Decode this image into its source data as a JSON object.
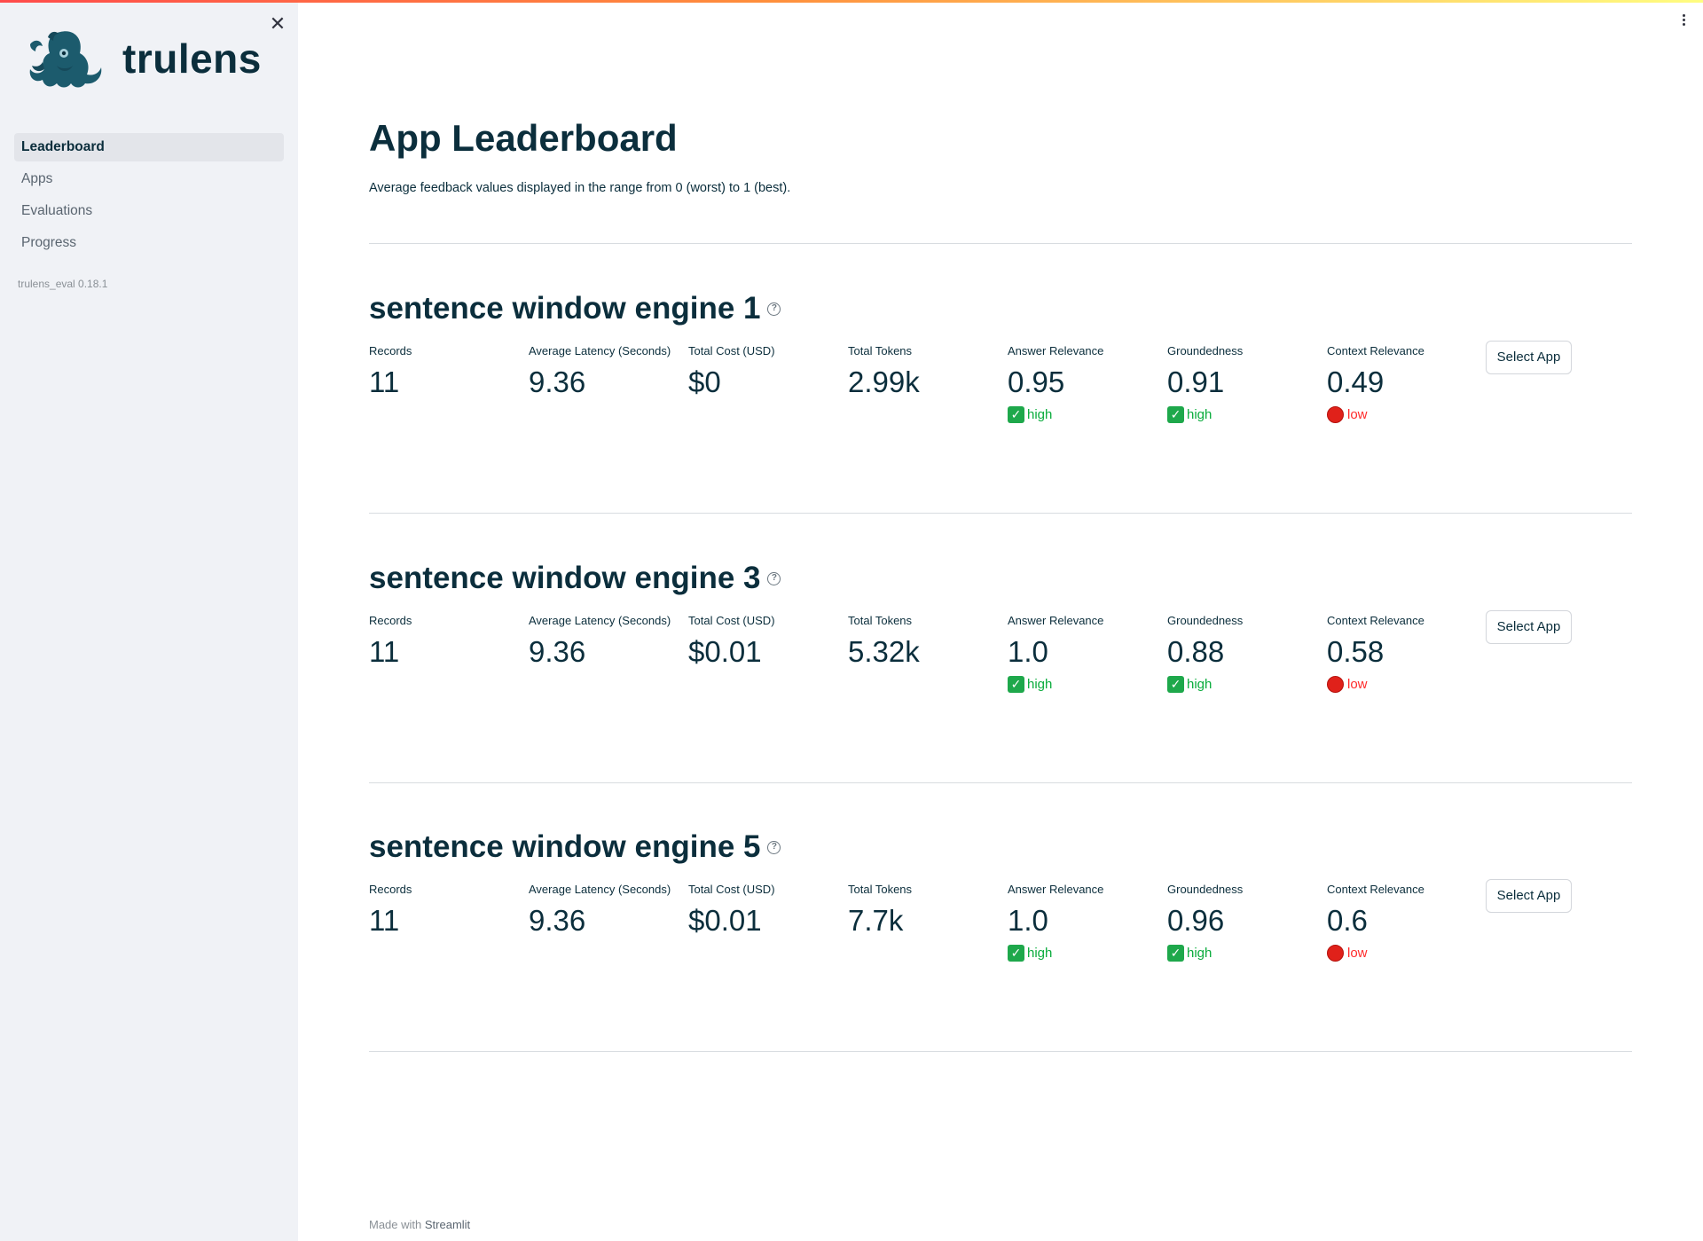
{
  "sidebar": {
    "logo_text": "trulens",
    "nav": [
      {
        "label": "Leaderboard",
        "active": true
      },
      {
        "label": "Apps",
        "active": false
      },
      {
        "label": "Evaluations",
        "active": false
      },
      {
        "label": "Progress",
        "active": false
      }
    ],
    "version": "trulens_eval 0.18.1"
  },
  "main": {
    "title": "App Leaderboard",
    "caption": "Average feedback values displayed in the range from 0 (worst) to 1 (best).",
    "apps": [
      {
        "name": "sentence window engine 1",
        "metrics": {
          "records": {
            "label": "Records",
            "value": "11"
          },
          "latency": {
            "label": "Average Latency (Seconds)",
            "value": "9.36"
          },
          "cost": {
            "label": "Total Cost (USD)",
            "value": "$0"
          },
          "tokens": {
            "label": "Total Tokens",
            "value": "2.99k"
          },
          "answer_relevance": {
            "label": "Answer Relevance",
            "value": "0.95",
            "delta": "high"
          },
          "groundedness": {
            "label": "Groundedness",
            "value": "0.91",
            "delta": "high"
          },
          "context_relevance": {
            "label": "Context Relevance",
            "value": "0.49",
            "delta": "low"
          }
        },
        "select_label": "Select App"
      },
      {
        "name": "sentence window engine 3",
        "metrics": {
          "records": {
            "label": "Records",
            "value": "11"
          },
          "latency": {
            "label": "Average Latency (Seconds)",
            "value": "9.36"
          },
          "cost": {
            "label": "Total Cost (USD)",
            "value": "$0.01"
          },
          "tokens": {
            "label": "Total Tokens",
            "value": "5.32k"
          },
          "answer_relevance": {
            "label": "Answer Relevance",
            "value": "1.0",
            "delta": "high"
          },
          "groundedness": {
            "label": "Groundedness",
            "value": "0.88",
            "delta": "high"
          },
          "context_relevance": {
            "label": "Context Relevance",
            "value": "0.58",
            "delta": "low"
          }
        },
        "select_label": "Select App"
      },
      {
        "name": "sentence window engine 5",
        "metrics": {
          "records": {
            "label": "Records",
            "value": "11"
          },
          "latency": {
            "label": "Average Latency (Seconds)",
            "value": "9.36"
          },
          "cost": {
            "label": "Total Cost (USD)",
            "value": "$0.01"
          },
          "tokens": {
            "label": "Total Tokens",
            "value": "7.7k"
          },
          "answer_relevance": {
            "label": "Answer Relevance",
            "value": "1.0",
            "delta": "high"
          },
          "groundedness": {
            "label": "Groundedness",
            "value": "0.96",
            "delta": "high"
          },
          "context_relevance": {
            "label": "Context Relevance",
            "value": "0.6",
            "delta": "low"
          }
        },
        "select_label": "Select App"
      }
    ]
  },
  "footer": {
    "prefix": "Made with ",
    "brand": "Streamlit"
  },
  "colors": {
    "high": "#09ab3b",
    "low": "#ff2b2b",
    "title": "#0b2e3c"
  },
  "icons": [
    "close-icon",
    "menu-icon",
    "help-icon",
    "check-icon",
    "stop-icon",
    "trulens-logo"
  ]
}
